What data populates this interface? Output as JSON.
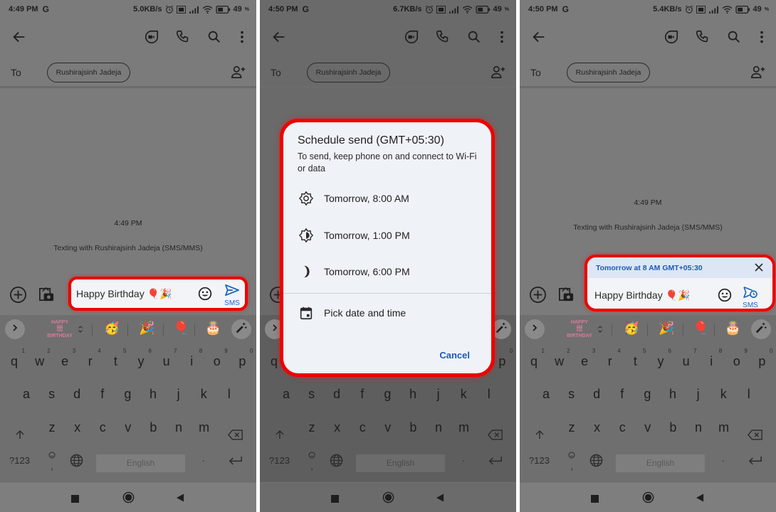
{
  "colors": {
    "highlight": "#ee0000",
    "accent_blue": "#1a66c2",
    "dialog_bg": "#eff2f7",
    "banner_bg": "#dde6f4"
  },
  "panels": [
    {
      "status": {
        "time": "4:49 PM",
        "carrier_icon": "G",
        "speed": "5.0KB/s",
        "battery": "49"
      },
      "to_label": "To",
      "recipient": "Rushirajsinh Jadeja",
      "conversation_time": "4:49 PM",
      "conversation_note": "Texting with Rushirajsinh Jadeja (SMS/MMS)",
      "message": "Happy Birthday 🎈🎉",
      "send_label": "SMS"
    },
    {
      "status": {
        "time": "4:50 PM",
        "carrier_icon": "G",
        "speed": "6.7KB/s",
        "battery": "49"
      },
      "to_label": "To",
      "recipient": "Rushirajsinh Jadeja",
      "dialog": {
        "title": "Schedule send (GMT+05:30)",
        "subtitle": "To send, keep phone on and connect to Wi-Fi or data",
        "options": [
          {
            "label": "Tomorrow, 8:00 AM",
            "icon": "sun-icon"
          },
          {
            "label": "Tomorrow, 1:00 PM",
            "icon": "half-sun-icon"
          },
          {
            "label": "Tomorrow, 6:00 PM",
            "icon": "moon-icon"
          }
        ],
        "pick_label": "Pick date and time",
        "cancel_label": "Cancel"
      }
    },
    {
      "status": {
        "time": "4:50 PM",
        "carrier_icon": "G",
        "speed": "5.4KB/s",
        "battery": "49"
      },
      "to_label": "To",
      "recipient": "Rushirajsinh Jadeja",
      "conversation_time": "4:49 PM",
      "conversation_note": "Texting with Rushirajsinh Jadeja (SMS/MMS)",
      "scheduled_banner": "Tomorrow at 8 AM GMT+05:30",
      "message": "Happy Birthday 🎈🎉",
      "send_label": "SMS"
    }
  ],
  "keyboard": {
    "row1": [
      "q",
      "w",
      "e",
      "r",
      "t",
      "y",
      "u",
      "i",
      "o",
      "p"
    ],
    "row1_hints": [
      "1",
      "2",
      "3",
      "4",
      "5",
      "6",
      "7",
      "8",
      "9",
      "0"
    ],
    "row2": [
      "a",
      "s",
      "d",
      "f",
      "g",
      "h",
      "j",
      "k",
      "l"
    ],
    "row3": [
      "z",
      "x",
      "c",
      "v",
      "b",
      "n",
      "m"
    ],
    "symbols_label": "?123",
    "comma": ",",
    "period": ".",
    "space_label": "English",
    "suggestions": {
      "sticker_text_top": "HAPPY",
      "sticker_text_bottom": "BIRTHDAY",
      "emojis": [
        "🥳",
        "🎉",
        "🎈",
        "🎂"
      ]
    }
  }
}
